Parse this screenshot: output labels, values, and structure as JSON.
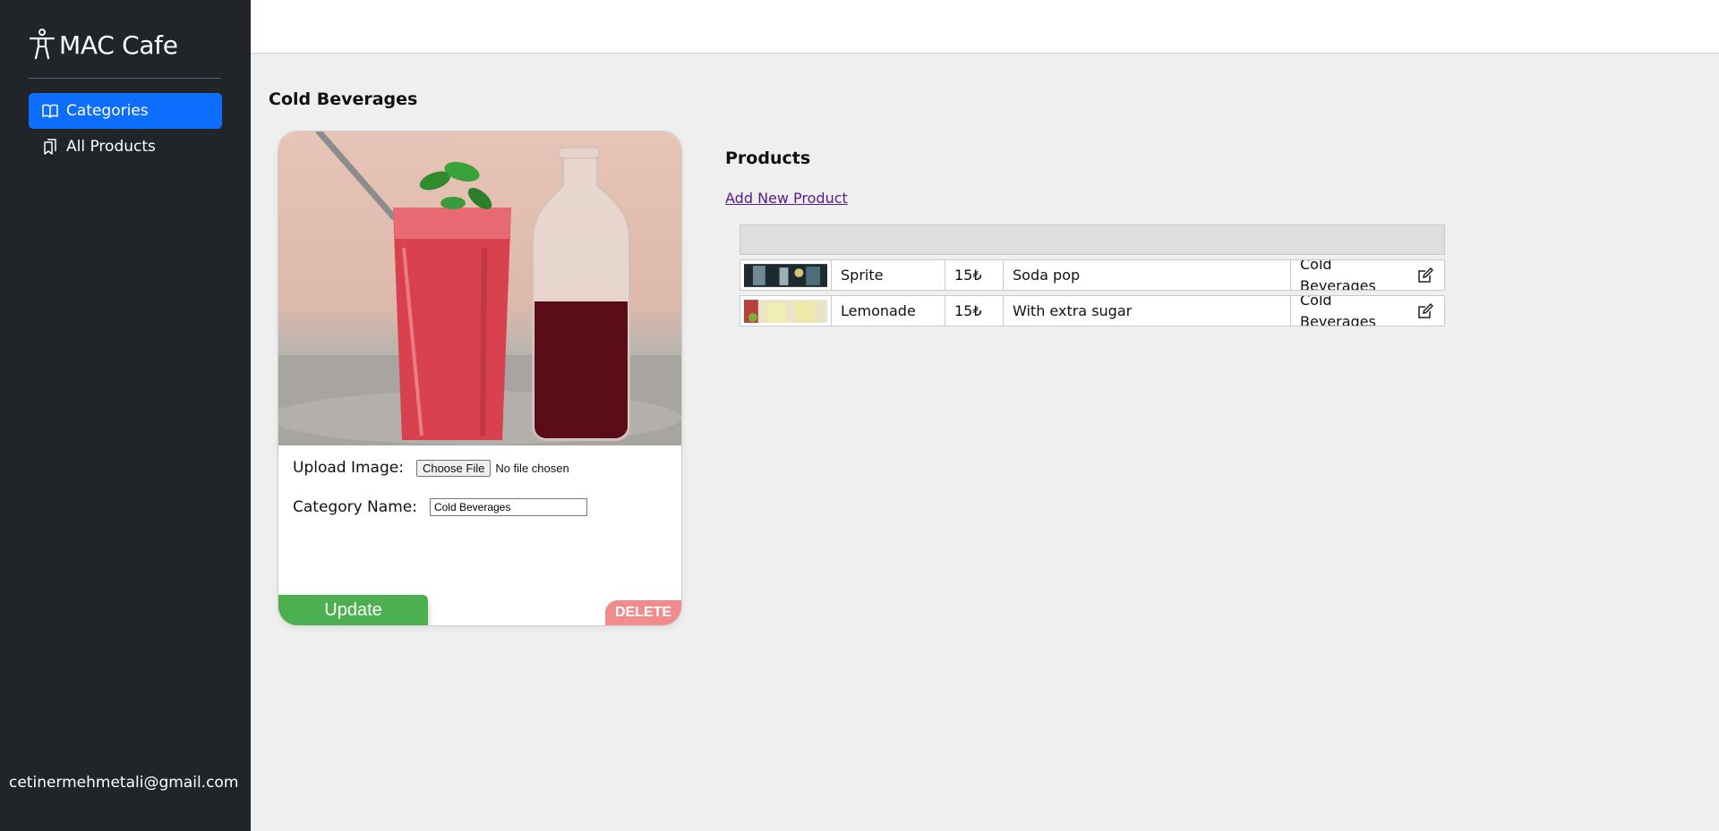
{
  "sidebar": {
    "brand": "MAC Cafe",
    "items": [
      {
        "label": "Categories",
        "icon": "book-icon",
        "active": true
      },
      {
        "label": "All Products",
        "icon": "bookmarks-icon",
        "active": false
      }
    ],
    "email": "cetinermehmetali@gmail.com"
  },
  "category": {
    "title": "Cold Beverages",
    "upload_label": "Upload Image:",
    "choose_file": "Choose File",
    "file_status": "No file chosen",
    "name_label": "Category Name:",
    "name_value": "Cold Beverages",
    "update_label": "Update",
    "delete_label": "DELETE"
  },
  "products": {
    "title": "Products",
    "add_link": "Add New Product",
    "rows": [
      {
        "name": "Sprite",
        "price": "15₺",
        "description": "Soda pop",
        "category": "Cold Beverages"
      },
      {
        "name": "Lemonade",
        "price": "15₺",
        "description": "With extra sugar",
        "category": "Cold Beverages"
      }
    ]
  },
  "colors": {
    "sidebar_bg": "#212529",
    "active_nav": "#0d6efd",
    "update_btn": "#4caf50",
    "delete_btn": "#f28b8b",
    "link": "#551a8b"
  }
}
